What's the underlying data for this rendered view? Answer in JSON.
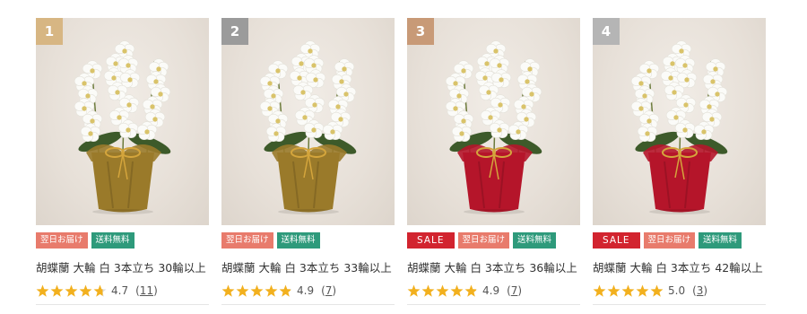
{
  "products": [
    {
      "rank": "1",
      "rank_color": "#d7b683",
      "wrap_color": "#9a7a2a",
      "badges": [
        {
          "type": "next",
          "label": "翌日お届け"
        },
        {
          "type": "free",
          "label": "送料無料"
        }
      ],
      "title": "胡蝶蘭 大輪 白 3本立ち 30輪以上",
      "rating": 4.7,
      "rating_text": "4.7",
      "review_count": "11"
    },
    {
      "rank": "2",
      "rank_color": "#9b9b9b",
      "wrap_color": "#9a7a2a",
      "badges": [
        {
          "type": "next",
          "label": "翌日お届け"
        },
        {
          "type": "free",
          "label": "送料無料"
        }
      ],
      "title": "胡蝶蘭 大輪 白 3本立ち 33輪以上",
      "rating": 4.9,
      "rating_text": "4.9",
      "review_count": "7"
    },
    {
      "rank": "3",
      "rank_color": "#c89a77",
      "wrap_color": "#b5152a",
      "badges": [
        {
          "type": "sale",
          "label": "SALE"
        },
        {
          "type": "next",
          "label": "翌日お届け"
        },
        {
          "type": "free",
          "label": "送料無料"
        }
      ],
      "title": "胡蝶蘭 大輪 白 3本立ち 36輪以上",
      "rating": 4.9,
      "rating_text": "4.9",
      "review_count": "7"
    },
    {
      "rank": "4",
      "rank_color": "#b5b5b5",
      "wrap_color": "#b5152a",
      "badges": [
        {
          "type": "sale",
          "label": "SALE"
        },
        {
          "type": "next",
          "label": "翌日お届け"
        },
        {
          "type": "free",
          "label": "送料無料"
        }
      ],
      "title": "胡蝶蘭 大輪 白 3本立ち 42輪以上",
      "rating": 5.0,
      "rating_text": "5.0",
      "review_count": "3"
    }
  ],
  "star_color": "#f2b01e",
  "star_empty_color": "#dddddd"
}
